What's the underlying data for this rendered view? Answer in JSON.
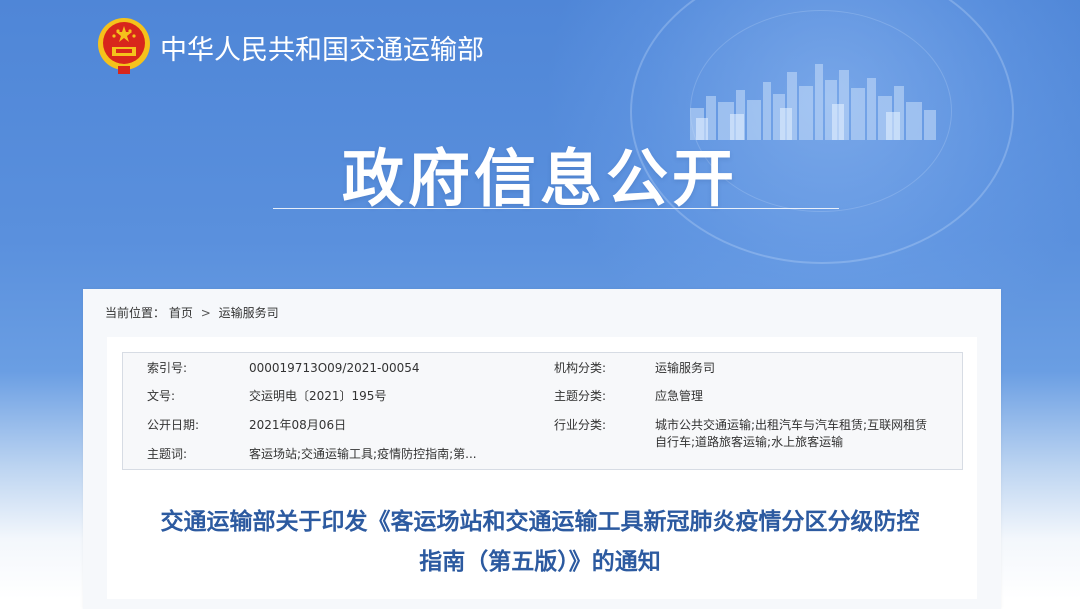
{
  "header": {
    "site_title": "中华人民共和国交通运输部",
    "hero_title": "政府信息公开"
  },
  "breadcrumb": {
    "label": "当前位置：",
    "items": [
      "首页",
      "运输服务司"
    ],
    "separator": ">"
  },
  "meta": {
    "left": [
      {
        "label": "索引号:",
        "value": "000019713O09/2021-00054"
      },
      {
        "label": "文号:",
        "value": "交运明电〔2021〕195号"
      },
      {
        "label": "公开日期:",
        "value": "2021年08月06日"
      },
      {
        "label": "主题词:",
        "value": "客运场站;交通运输工具;疫情防控指南;第..."
      }
    ],
    "right": [
      {
        "label": "机构分类:",
        "value": "运输服务司"
      },
      {
        "label": "主题分类:",
        "value": "应急管理"
      },
      {
        "label": "行业分类:",
        "value": "城市公共交通运输;出租汽车与汽车租赁;互联网租赁自行车;道路旅客运输;水上旅客运输"
      }
    ]
  },
  "document": {
    "title_line1": "交通运输部关于印发《客运场站和交通运输工具新冠肺炎疫情分区分级防控",
    "title_line2": "指南（第五版）》的通知"
  },
  "colors": {
    "banner_blue": "#4f86d7",
    "title_blue": "#2c5aa0",
    "emblem_red": "#d8261c",
    "emblem_gold": "#f5c21b"
  },
  "icons": [
    "national-emblem-icon",
    "city-skyline-graphic"
  ]
}
